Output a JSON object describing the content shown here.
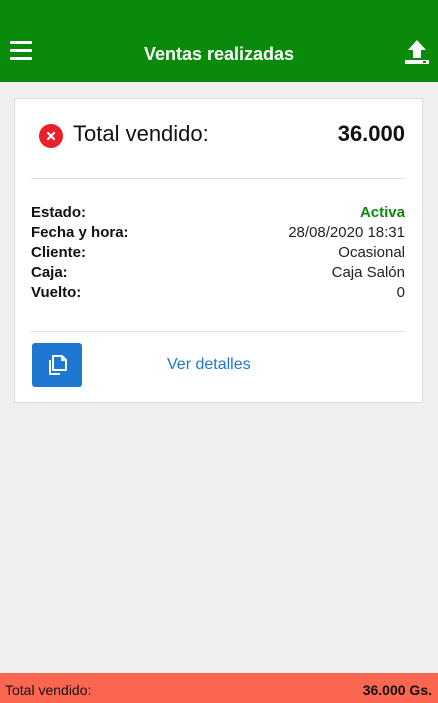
{
  "appbar": {
    "title": "Ventas realizadas",
    "menu_icon": "menu-icon",
    "upload_icon": "upload-icon",
    "background": "#0a8a0a"
  },
  "sale_card": {
    "status_icon": "error-x-icon",
    "total_label": "Total vendido:",
    "total_value": "36.000",
    "details": [
      {
        "label": "Estado:",
        "value": "Activa",
        "value_color": "#0a8a0a"
      },
      {
        "label": "Fecha y hora:",
        "value": "28/08/2020 18:31"
      },
      {
        "label": "Cliente:",
        "value": "Ocasional"
      },
      {
        "label": "Caja:",
        "value": "Caja Salón"
      },
      {
        "label": "Vuelto:",
        "value": "0"
      }
    ],
    "copy_icon": "copy-icon",
    "details_link": "Ver detalles",
    "accent_color": "#1e78d2"
  },
  "footer": {
    "label": "Total vendido:",
    "value": "36.000 Gs.",
    "background": "#fb6650"
  }
}
